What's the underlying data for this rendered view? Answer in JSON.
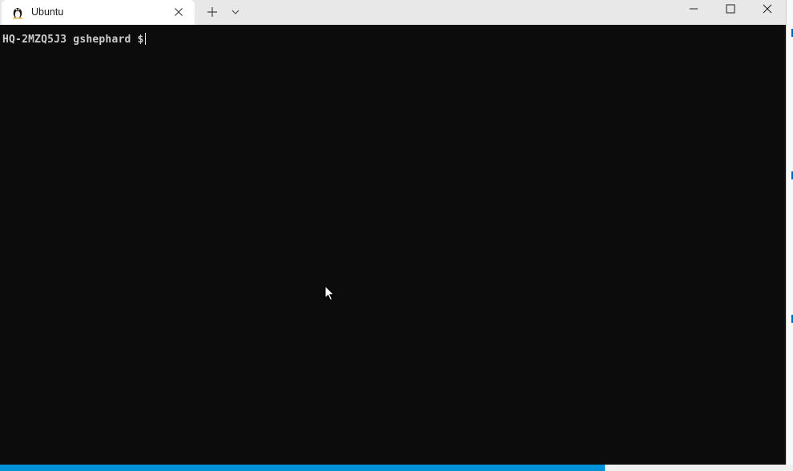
{
  "window": {
    "tab_title": "Ubuntu",
    "tab_icon": "linux-penguin-icon",
    "buttons": [
      "new-tab",
      "tab-dropdown",
      "minimize",
      "maximize",
      "close"
    ]
  },
  "terminal": {
    "prompt": "HQ-2MZQ5J3 gshephard $",
    "background": "#0c0c0c",
    "foreground": "#cccccc"
  },
  "theme": {
    "titlebar": "#e8e8e8",
    "accent": "#0091d9"
  }
}
